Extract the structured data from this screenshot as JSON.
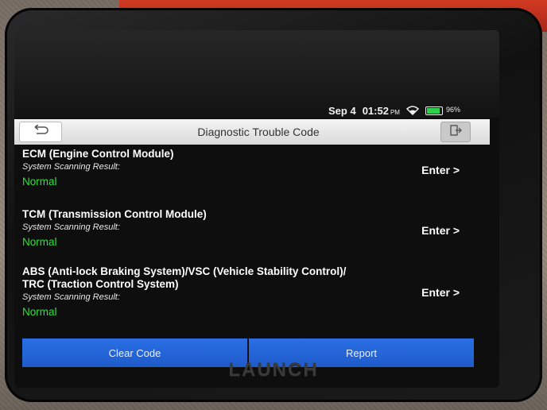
{
  "status": {
    "date": "Sep 4",
    "time": "01:52",
    "ampm": "PM",
    "battery": "96%",
    "battery_level": 0.96
  },
  "header": {
    "title": "Diagnostic Trouble Code"
  },
  "modules": [
    {
      "name": "ECM (Engine Control Module)",
      "sub": "System Scanning Result:",
      "result": "Normal",
      "enter": "Enter >"
    },
    {
      "name": "TCM (Transmission Control Module)",
      "sub": "System Scanning Result:",
      "result": "Normal",
      "enter": "Enter >"
    },
    {
      "name": "ABS (Anti-lock Braking System)/VSC (Vehicle Stability Control)/",
      "name2": "TRC (Traction Control System)",
      "sub": "System Scanning Result:",
      "result": "Normal",
      "enter": "Enter >"
    }
  ],
  "footer": {
    "clear": "Clear Code",
    "report": "Report"
  },
  "brand": "LAUNCH",
  "icons": {
    "back": "back-arrow-icon",
    "exit": "exit-icon",
    "wifi": "wifi-icon",
    "battery": "battery-icon"
  },
  "colors": {
    "accent": "#1f5bc9",
    "ok": "#2fe03c"
  }
}
